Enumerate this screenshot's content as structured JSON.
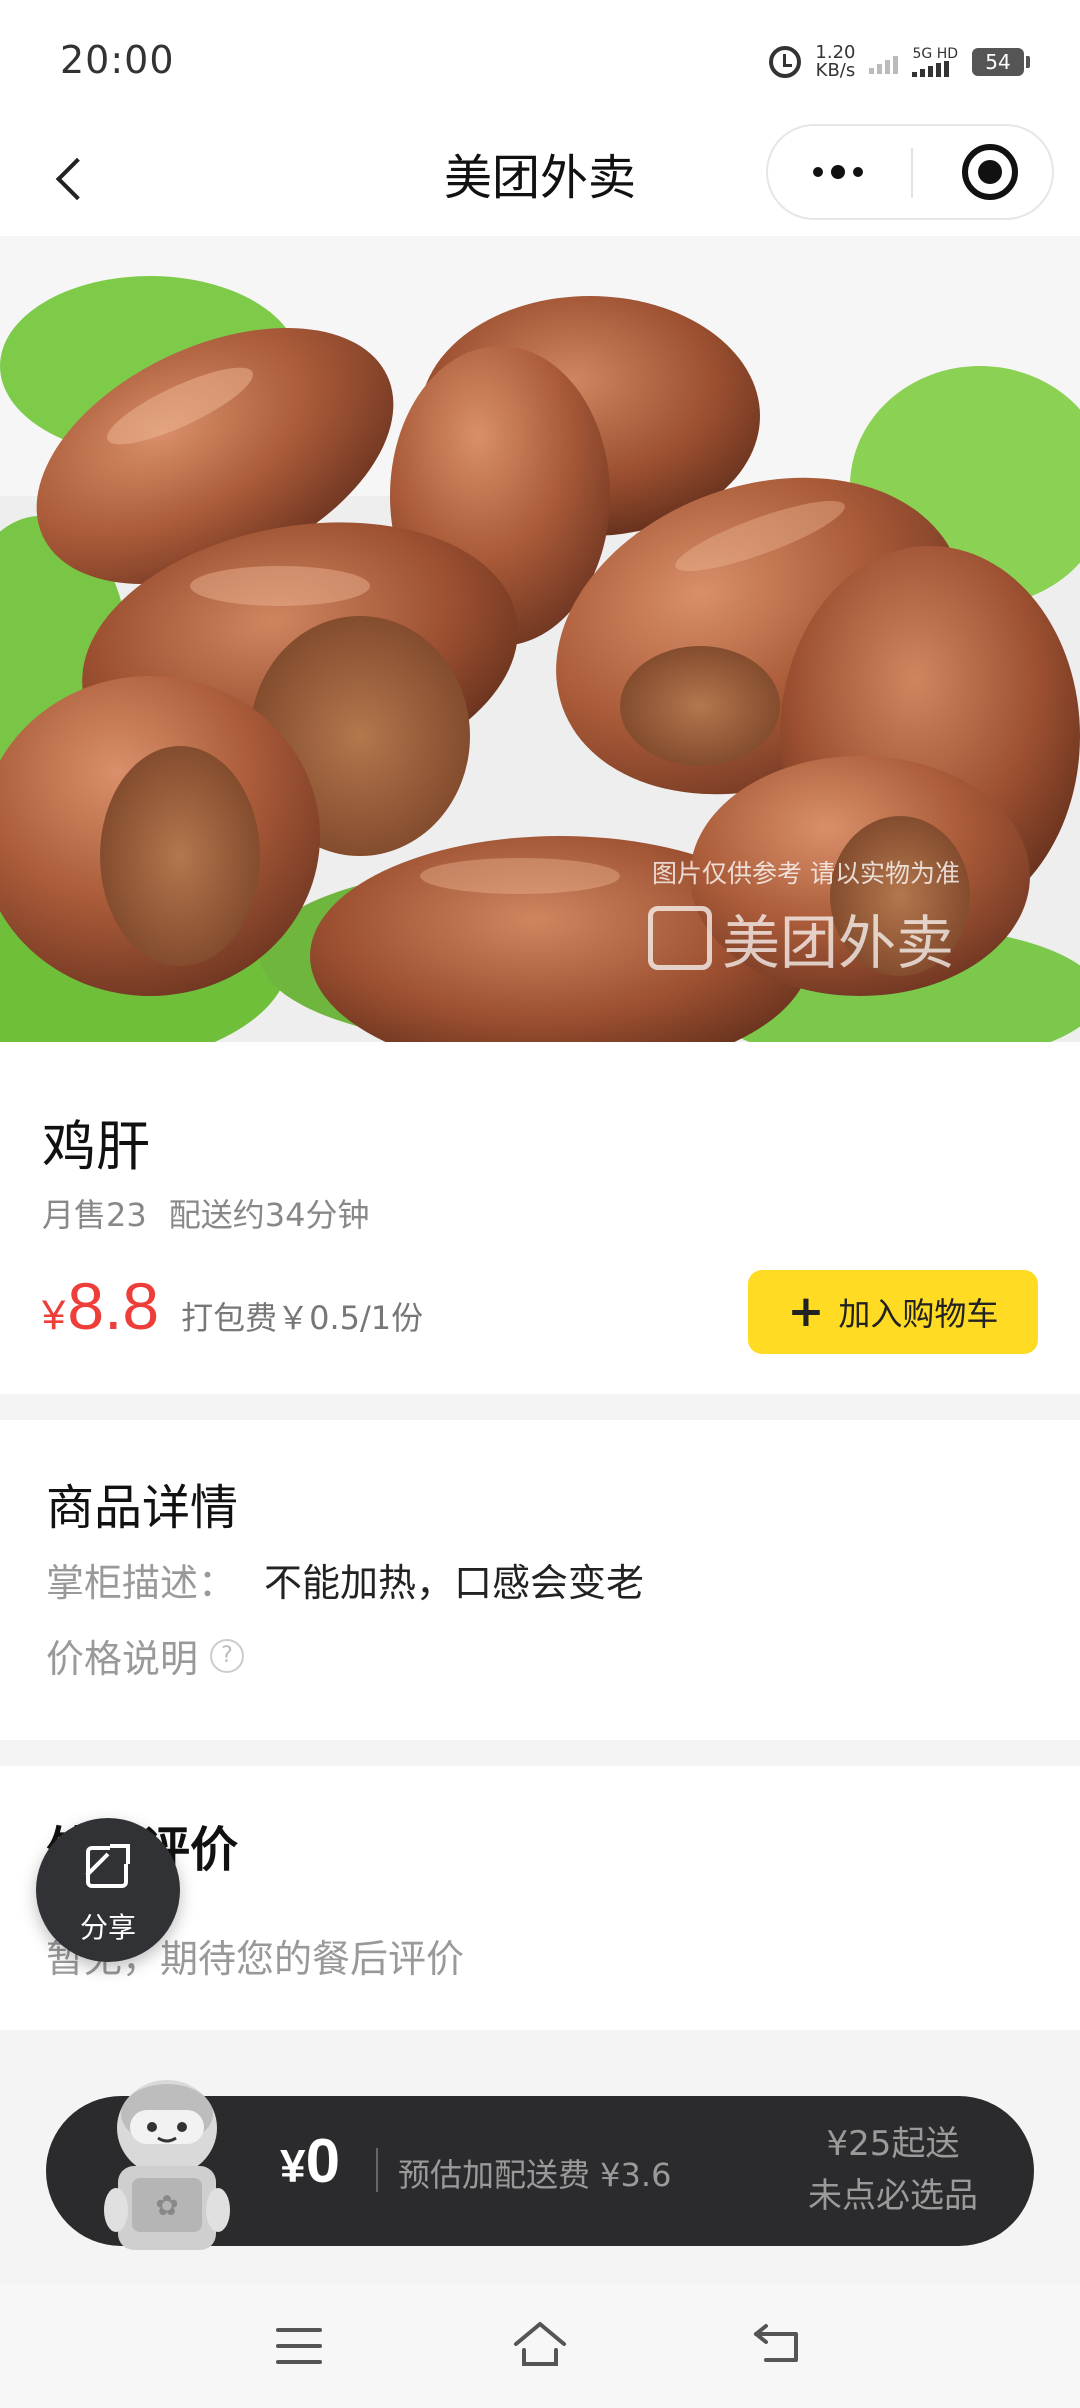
{
  "status_bar": {
    "time": "20:00",
    "speed_value": "1.20",
    "speed_unit": "KB/s",
    "network": "5G HD",
    "battery": "54"
  },
  "nav": {
    "title": "美团外卖"
  },
  "image": {
    "watermark_note": "图片仅供参考 请以实物为准",
    "watermark_logo": "美团外卖"
  },
  "product": {
    "name": "鸡肝",
    "monthly_sales": "月售23",
    "delivery_time": "配送约34分钟",
    "price_symbol": "¥",
    "price": "8.8",
    "packing_fee": "打包费￥0.5/1份",
    "add_to_cart": "加入购物车"
  },
  "detail": {
    "title": "商品详情",
    "owner_label": "掌柜描述：",
    "owner_value": "不能加热，口感会变老",
    "price_note": "价格说明"
  },
  "reviews": {
    "title": "外卖评价",
    "empty_text": "暂无，期待您的餐后评价"
  },
  "share": {
    "label": "分享"
  },
  "cart": {
    "currency": "¥",
    "total": "0",
    "delivery_fee": "预估加配送费 ¥3.6",
    "min_order": "¥25起送",
    "required_items": "未点必选品"
  },
  "colors": {
    "accent_yellow": "#ffdc23",
    "price_red": "#ee3e3a",
    "cart_dark": "#2b2b2d"
  }
}
